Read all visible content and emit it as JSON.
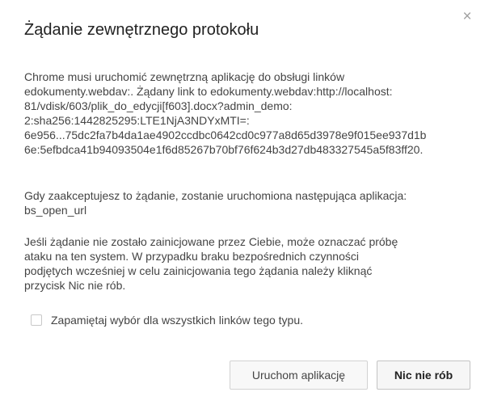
{
  "dialog": {
    "title": "Żądanie zewnętrznego protokołu",
    "close_symbol": "×",
    "close_icon": "close-icon",
    "paragraph1": [
      "Chrome musi uruchomić zewnętrzną aplikację do obsługi linków",
      "edokumenty.webdav:. Żądany link to edokumenty.webdav:http://localhost:",
      "81/vdisk/603/plik_do_edycji[f603].docx?admin_demo:",
      "2:sha256:1442825295:LTE1NjA3NDYxMTI=:",
      "6e956...75dc2fa7b4da1ae4902ccdbc0642cd0c977a8d65d3978e9f015ee937d1b",
      "6e:5efbdca41b94093504e1f6d85267b70bf76f624b3d27db483327545a5f83ff20."
    ],
    "paragraph2": [
      "Gdy zaakceptujesz to żądanie, zostanie uruchomiona następująca aplikacja:",
      "bs_open_url"
    ],
    "paragraph3": [
      "Jeśli żądanie nie zostało zainicjowane przez Ciebie, może oznaczać próbę",
      "ataku na ten system. W przypadku braku bezpośrednich czynności",
      "podjętych wcześniej w celu zainicjowania tego żądania należy kliknąć",
      "przycisk Nic nie rób."
    ],
    "checkbox_label": "Zapamiętaj wybór dla wszystkich linków tego typu.",
    "checkbox_checked": false,
    "buttons": {
      "launch": "Uruchom aplikację",
      "do_nothing": "Nic nie rób"
    }
  }
}
